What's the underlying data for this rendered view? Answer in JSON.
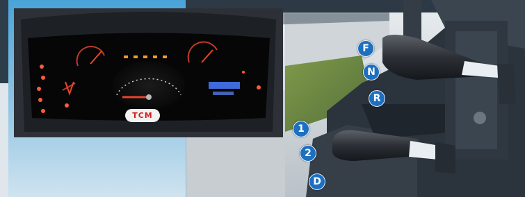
{
  "cluster": {
    "brand_logo": "TCM",
    "needle_color": "#e8462a",
    "warning_light_color": "#ff5a3a",
    "display_color": "#4a7cff"
  },
  "lever_upper": {
    "positions": [
      "F",
      "N",
      "R"
    ],
    "badge_color": "#1d6fc0"
  },
  "lever_lower": {
    "positions": [
      "1",
      "2",
      "D"
    ],
    "badge_color": "#1d6fc0"
  }
}
